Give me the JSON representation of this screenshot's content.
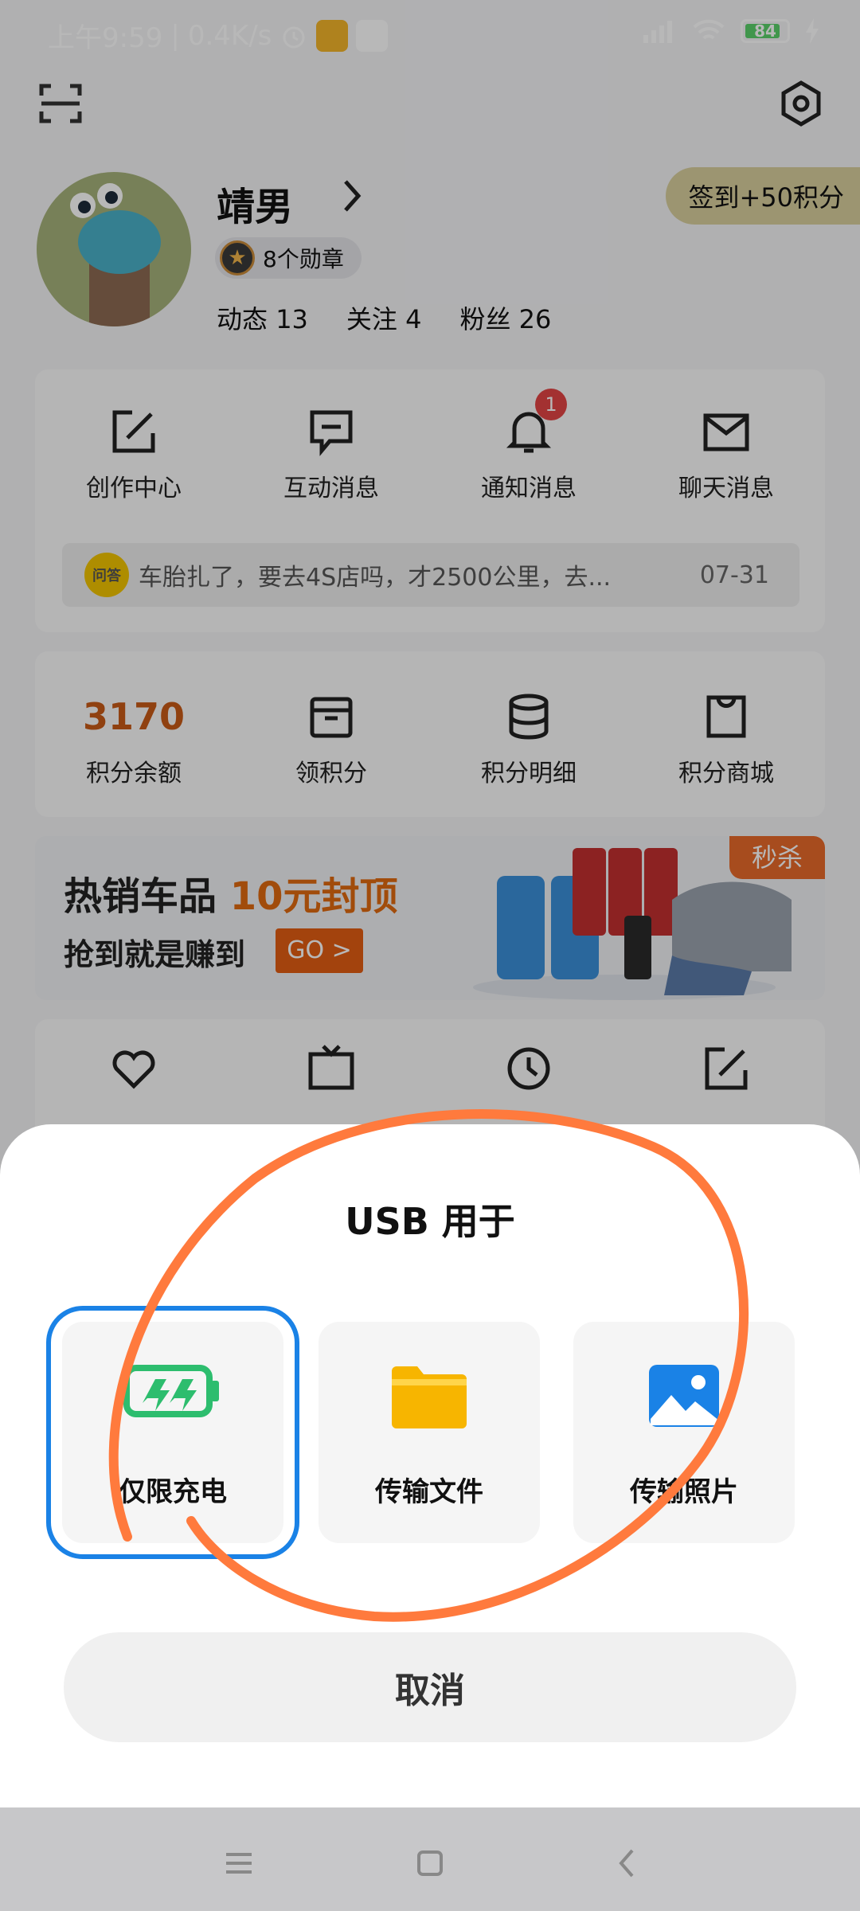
{
  "status_bar": {
    "time": "上午9:59",
    "net_speed": "0.4K/s",
    "battery": "84"
  },
  "profile": {
    "name": "靖男",
    "checkin": "签到+50积分",
    "medals": "8个勋章",
    "stats": [
      {
        "label": "动态",
        "value": "13"
      },
      {
        "label": "关注",
        "value": "4"
      },
      {
        "label": "粉丝",
        "value": "26"
      }
    ]
  },
  "messages": {
    "items": [
      {
        "label": "创作中心",
        "icon": "edit-icon"
      },
      {
        "label": "互动消息",
        "icon": "comment-icon"
      },
      {
        "label": "通知消息",
        "icon": "bell-icon",
        "badge": "1"
      },
      {
        "label": "聊天消息",
        "icon": "mail-icon"
      }
    ],
    "notice": {
      "logo": "问答",
      "text": "车胎扎了，要去4S店吗，才2500公里，去...",
      "date": "07-31"
    }
  },
  "points": {
    "balance_value": "3170",
    "items": [
      {
        "label": "积分余额"
      },
      {
        "label": "领积分",
        "icon": "gift-box-icon"
      },
      {
        "label": "积分明细",
        "icon": "database-icon"
      },
      {
        "label": "积分商城",
        "icon": "shopping-bag-icon"
      }
    ]
  },
  "promo": {
    "title_prefix": "热销车品 ",
    "title_highlight": "10元封顶",
    "subtitle": "抢到就是赚到",
    "go": "GO >",
    "tag": "秒杀"
  },
  "usb_sheet": {
    "title": "USB 用于",
    "options": [
      {
        "label": "仅限充电",
        "icon": "battery-charging-icon",
        "selected": true,
        "color": "#2dbd6e"
      },
      {
        "label": "传输文件",
        "icon": "folder-icon",
        "selected": false,
        "color": "#f7b500"
      },
      {
        "label": "传输照片",
        "icon": "image-icon",
        "selected": false,
        "color": "#1a82e6"
      }
    ],
    "cancel": "取消"
  },
  "colors": {
    "selection": "#1a82e6",
    "annotation_stroke": "#ff7a3d",
    "points_accent": "#c85a17"
  }
}
